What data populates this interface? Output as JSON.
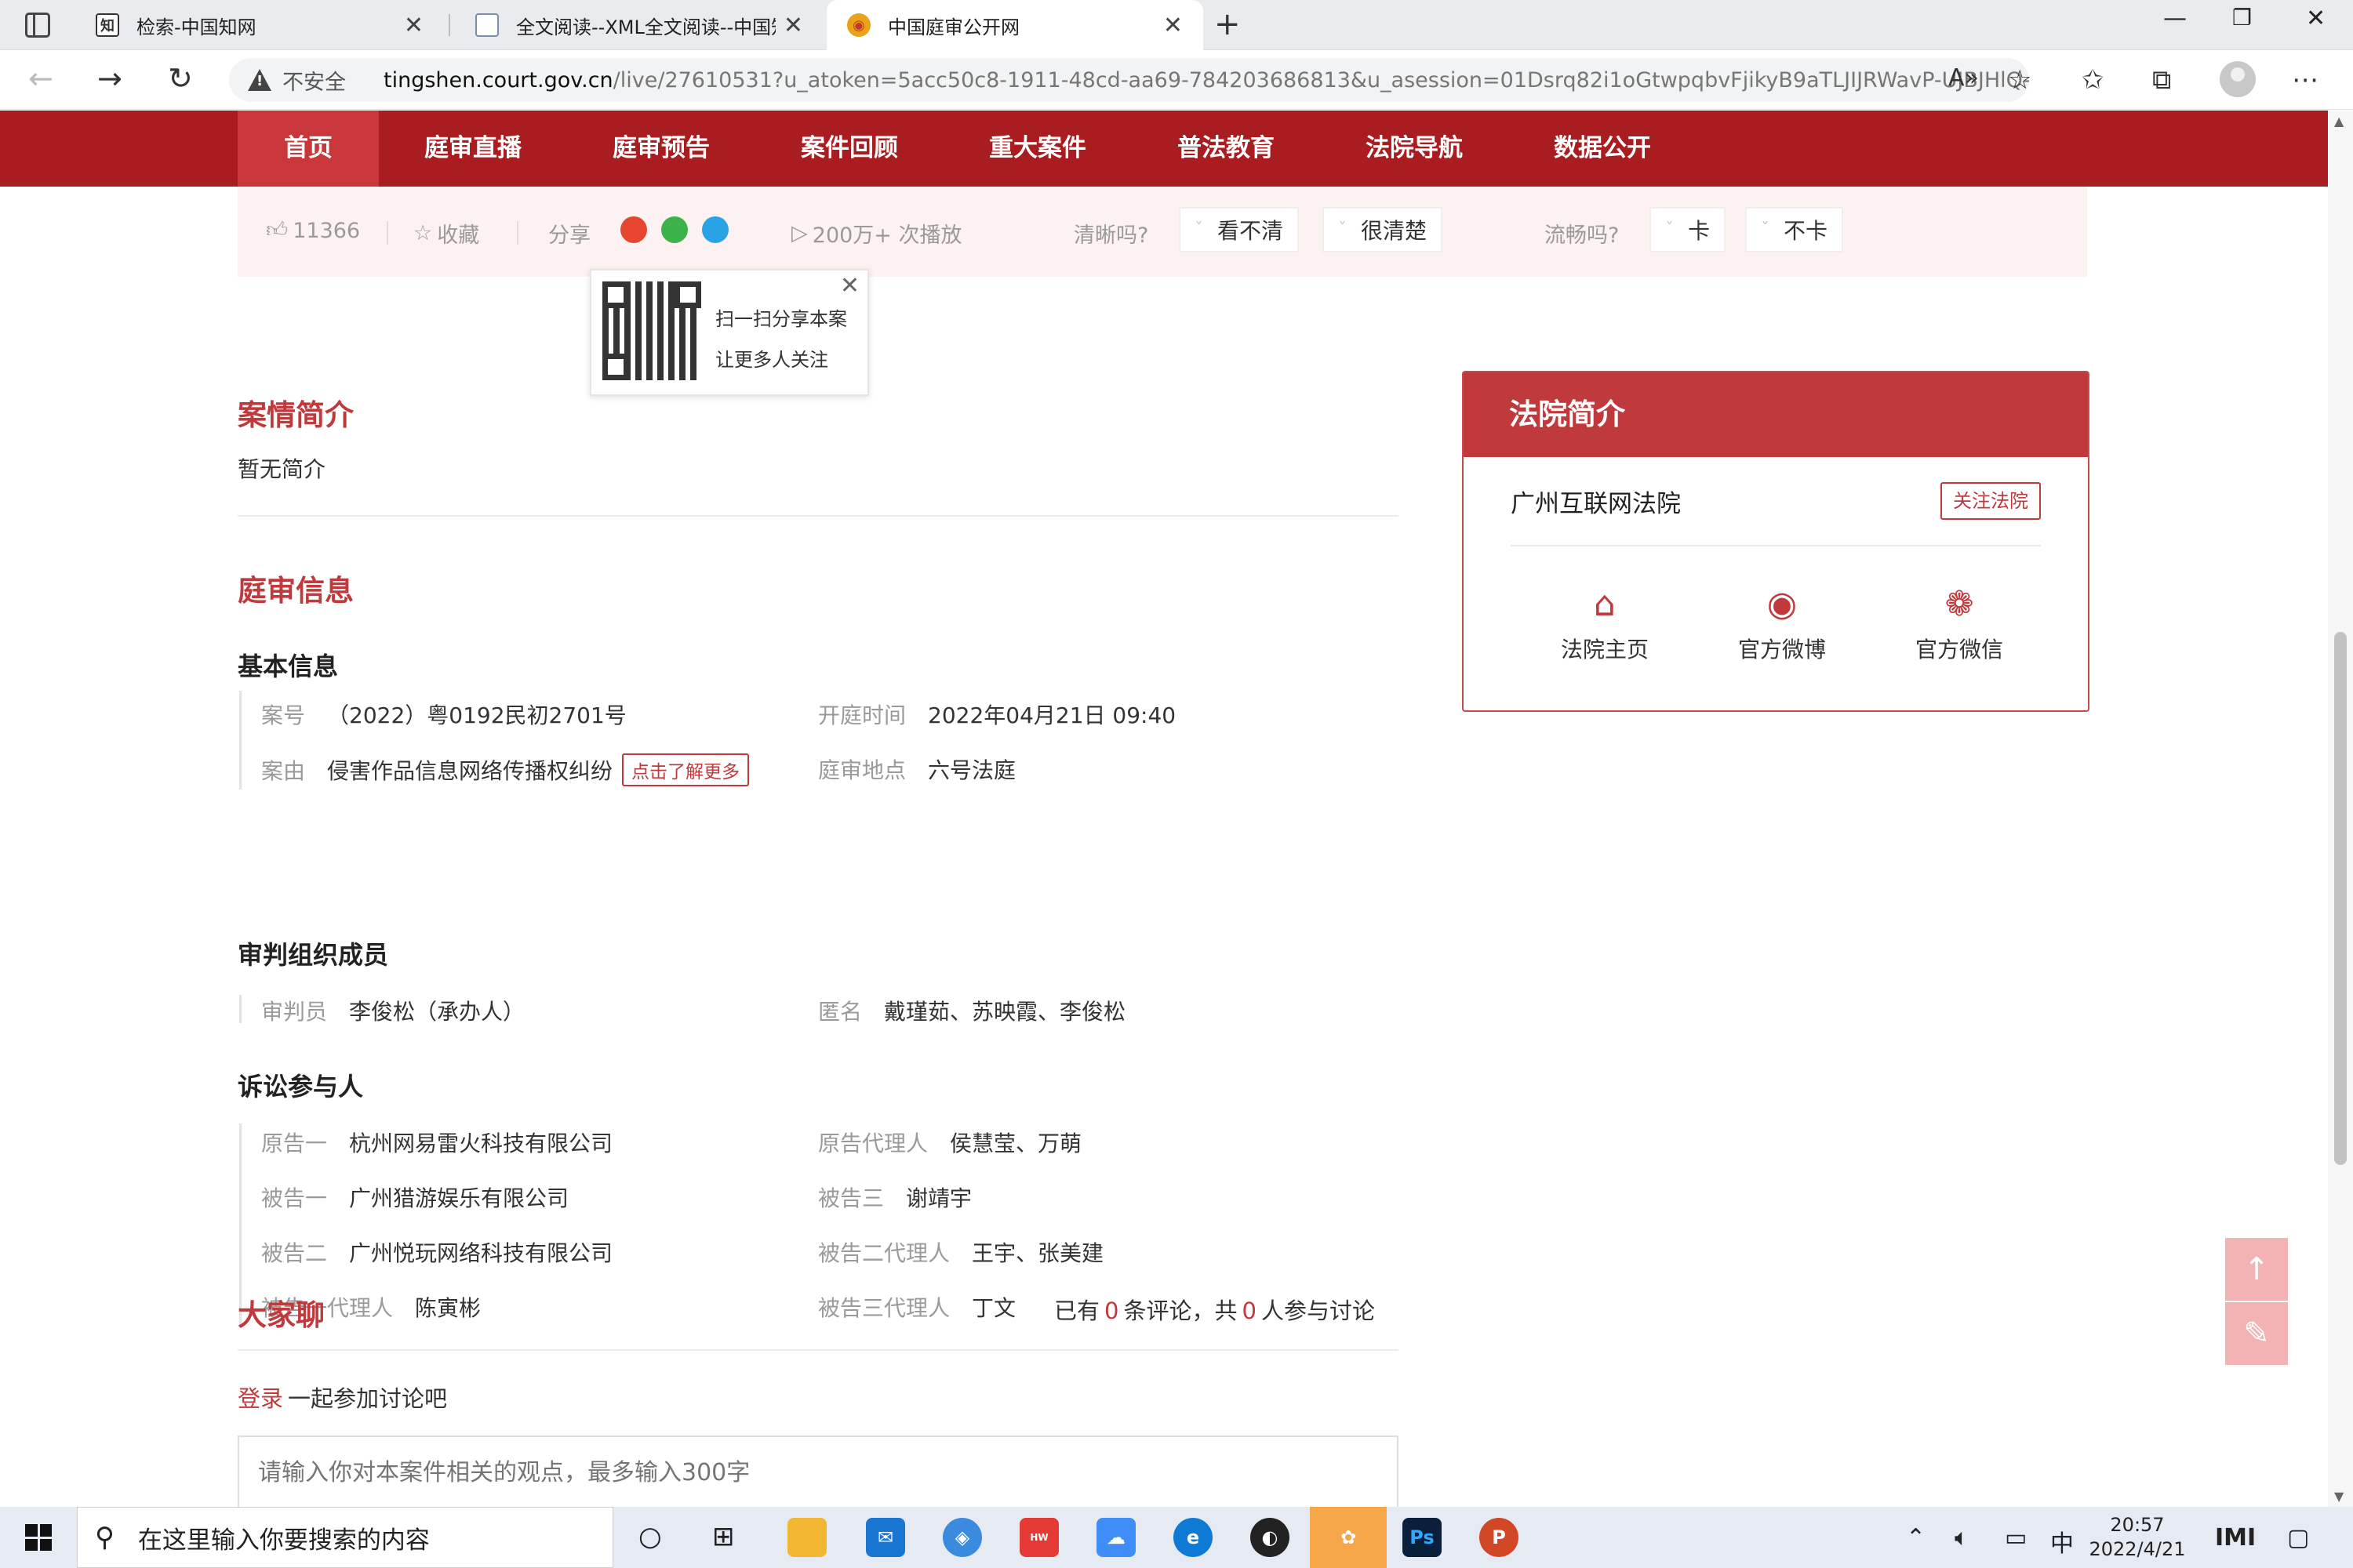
{
  "browser": {
    "tabs": [
      {
        "title": "检索-中国知网",
        "favicon": "cnki-icon"
      },
      {
        "title": "全文阅读--XML全文阅读--中国知",
        "favicon": "document-icon"
      },
      {
        "title": "中国庭审公开网",
        "favicon": "court-emblem-icon"
      }
    ],
    "insecure_label": "不安全",
    "url_host": "tingshen.court.gov.cn",
    "url_path": "/live/27610531?u_atoken=5acc50c8-1911-48cd-aa69-784203686813&u_asession=01Dsrq82i1oGtwpqbvFjikyB9aTLJIJRWavP-UJBJHlQ-d..."
  },
  "nav": {
    "items": [
      "首页",
      "庭审直播",
      "庭审预告",
      "案件回顾",
      "重大案件",
      "普法教育",
      "法院导航",
      "数据公开"
    ],
    "active_index": 0,
    "bg_color": "#a91c20",
    "active_color": "#c9373a"
  },
  "stats": {
    "likes": "11366",
    "favorite": "收藏",
    "share": "分享",
    "plays": "200万+ 次播放",
    "clarity_q": "清晰吗?",
    "clarity_bad": "看不清",
    "clarity_good": "很清楚",
    "smooth_q": "流畅吗?",
    "smooth_bad": "卡",
    "smooth_good": "不卡"
  },
  "qr_popup": {
    "line1": "扫一扫分享本案",
    "line2": "让更多人关注"
  },
  "case_intro": {
    "title": "案情简介",
    "text": "暂无简介"
  },
  "trial_info": {
    "title": "庭审信息",
    "basic": {
      "title": "基本信息",
      "case_no_label": "案号",
      "case_no": "（2022）粤0192民初2701号",
      "open_time_label": "开庭时间",
      "open_time": "2022年04月21日 09:40",
      "cause_label": "案由",
      "cause": "侵害作品信息网络传播权纠纷",
      "learn_more": "点击了解更多",
      "location_label": "庭审地点",
      "location": "六号法庭"
    },
    "panel": {
      "title": "审判组织成员",
      "judge_label": "审判员",
      "judge": "李俊松（承办人）",
      "anon_label": "匿名",
      "anon": "戴瑾茹、苏映霞、李俊松"
    },
    "parties": {
      "title": "诉讼参与人",
      "rows": [
        {
          "left_label": "原告一",
          "left_value": "杭州网易雷火科技有限公司",
          "right_label": "原告代理人",
          "right_value": "侯慧莹、万萌"
        },
        {
          "left_label": "被告一",
          "left_value": "广州猎游娱乐有限公司",
          "right_label": "被告三",
          "right_value": "谢靖宇"
        },
        {
          "left_label": "被告二",
          "left_value": "广州悦玩网络科技有限公司",
          "right_label": "被告二代理人",
          "right_value": "王宇、张美建"
        },
        {
          "left_label": "被告一代理人",
          "left_value": "陈寅彬",
          "right_label": "被告三代理人",
          "right_value": "丁文"
        }
      ]
    }
  },
  "court": {
    "header": "法院简介",
    "name": "广州互联网法院",
    "follow": "关注法院",
    "links": [
      {
        "label": "法院主页",
        "icon": "home-icon"
      },
      {
        "label": "官方微博",
        "icon": "weibo-icon"
      },
      {
        "label": "官方微信",
        "icon": "wechat-icon"
      }
    ]
  },
  "discussion": {
    "title": "大家聊",
    "prefix": "已有",
    "comments": "0",
    "mid": "条评论，共",
    "participants": "0",
    "suffix": "人参与讨论",
    "login": "登录",
    "login_suffix": "一起参加讨论吧",
    "placeholder": "请输入你对本案件相关的观点，最多输入300字"
  },
  "taskbar": {
    "search_placeholder": "在这里输入你要搜索的内容",
    "ime": "中",
    "time": "20:57",
    "date": "2022/4/21"
  }
}
